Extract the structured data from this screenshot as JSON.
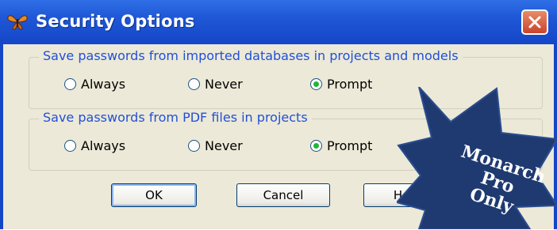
{
  "window": {
    "title": "Security Options"
  },
  "groups": [
    {
      "title": "Save passwords from imported databases in projects and models",
      "options": [
        "Always",
        "Never",
        "Prompt"
      ],
      "selected": "Prompt"
    },
    {
      "title": "Save passwords from PDF files in projects",
      "options": [
        "Always",
        "Never",
        "Prompt"
      ],
      "selected": "Prompt"
    }
  ],
  "buttons": {
    "ok": "OK",
    "cancel": "Cancel",
    "help": "Help"
  },
  "badge": {
    "line1": "Monarch",
    "line2": "Pro",
    "line3": "Only",
    "color": "#1f3a70"
  },
  "colors": {
    "titlebar": "#1f57d6",
    "dialog_bg": "#ece9d8",
    "group_title": "#2250d6",
    "radio_selected": "#23b43a"
  }
}
